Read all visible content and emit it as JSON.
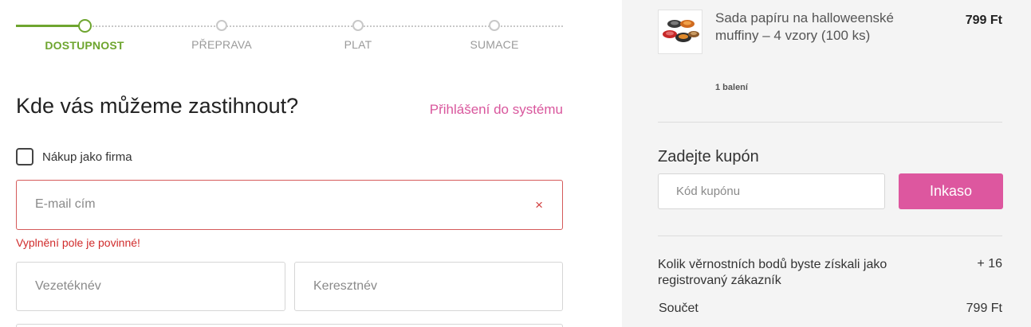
{
  "checkout_steps": [
    {
      "label": "DOSTUPNOST",
      "state": "active"
    },
    {
      "label": "PŘEPRAVA",
      "state": "pending"
    },
    {
      "label": "PLAT",
      "state": "pending"
    },
    {
      "label": "SUMACE",
      "state": "pending"
    }
  ],
  "form": {
    "heading": "Kde vás můžeme zastihnout?",
    "login_link": "Přihlášení do systému",
    "company_checkbox_label": "Nákup jako firma",
    "company_checked": false,
    "email_placeholder": "E-mail cím",
    "email_value": "",
    "email_clear_icon": "×",
    "email_error": "Vyplnění pole je povinné!",
    "last_name_placeholder": "Vezetéknév",
    "first_name_placeholder": "Keresztnév"
  },
  "cart": {
    "item": {
      "name": "Sada papíru na halloweenské muffiny – 4 vzory (100 ks)",
      "price": "799 Ft",
      "quantity": "1 balení",
      "image": "product-thumbnail"
    },
    "coupon": {
      "title": "Zadejte kupón",
      "placeholder": "Kód kupónu",
      "button": "Inkaso"
    },
    "loyalty_label": "Kolik věrnostních bodů byste získali jako registrovaný zákazník",
    "loyalty_value": "+ 16",
    "subtotal_label": "Součet",
    "subtotal_value": "799 Ft"
  },
  "colors": {
    "accent_green": "#6ea52f",
    "accent_pink": "#d9579d",
    "error_red": "#d02b2b",
    "sidebar_bg": "#f4f4f4"
  }
}
